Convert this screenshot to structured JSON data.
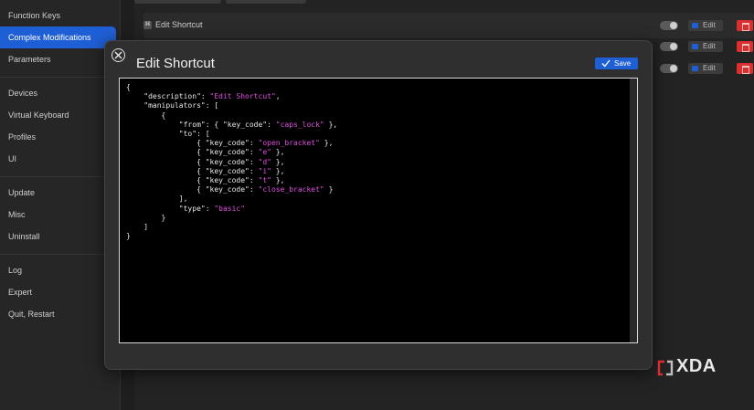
{
  "sidebar": {
    "items": [
      {
        "label": "Function Keys",
        "active": false
      },
      {
        "label": "Complex Modifications",
        "active": true
      },
      {
        "label": "Parameters",
        "active": false
      },
      {
        "label": "Devices",
        "active": false
      },
      {
        "label": "Virtual Keyboard",
        "active": false
      },
      {
        "label": "Profiles",
        "active": false
      },
      {
        "label": "UI",
        "active": false
      },
      {
        "label": "Update",
        "active": false
      },
      {
        "label": "Misc",
        "active": false
      },
      {
        "label": "Uninstall",
        "active": false
      },
      {
        "label": "Log",
        "active": false
      },
      {
        "label": "Expert",
        "active": false
      },
      {
        "label": "Quit, Restart",
        "active": false
      }
    ]
  },
  "rules": {
    "first_title": "Edit Shortcut",
    "edit_label": "Edit"
  },
  "modal": {
    "title": "Edit Shortcut",
    "save_label": "Save",
    "code_lines": [
      [
        "{"
      ],
      [
        "    \"description\": ",
        {
          "s": "\"Edit Shortcut\""
        },
        ","
      ],
      [
        "    \"manipulators\": ["
      ],
      [
        "        {"
      ],
      [
        "            \"from\": { \"key_code\": ",
        {
          "s": "\"caps_lock\""
        },
        " },"
      ],
      [
        "            \"to\": ["
      ],
      [
        "                { \"key_code\": ",
        {
          "s": "\"open_bracket\""
        },
        " },"
      ],
      [
        "                { \"key_code\": ",
        {
          "s": "\"e\""
        },
        " },"
      ],
      [
        "                { \"key_code\": ",
        {
          "s": "\"d\""
        },
        " },"
      ],
      [
        "                { \"key_code\": ",
        {
          "s": "\"i\""
        },
        " },"
      ],
      [
        "                { \"key_code\": ",
        {
          "s": "\"t\""
        },
        " },"
      ],
      [
        "                { \"key_code\": ",
        {
          "s": "\"close_bracket\""
        },
        " }"
      ],
      [
        "            ],"
      ],
      [
        "            \"type\": ",
        {
          "s": "\"basic\""
        }
      ],
      [
        "        }"
      ],
      [
        "    ]"
      ],
      [
        "}"
      ]
    ]
  },
  "watermark": {
    "text": "XDA"
  },
  "colors": {
    "accent": "#1f5fd6",
    "string": "#e04fe0",
    "danger": "#d9302f"
  }
}
